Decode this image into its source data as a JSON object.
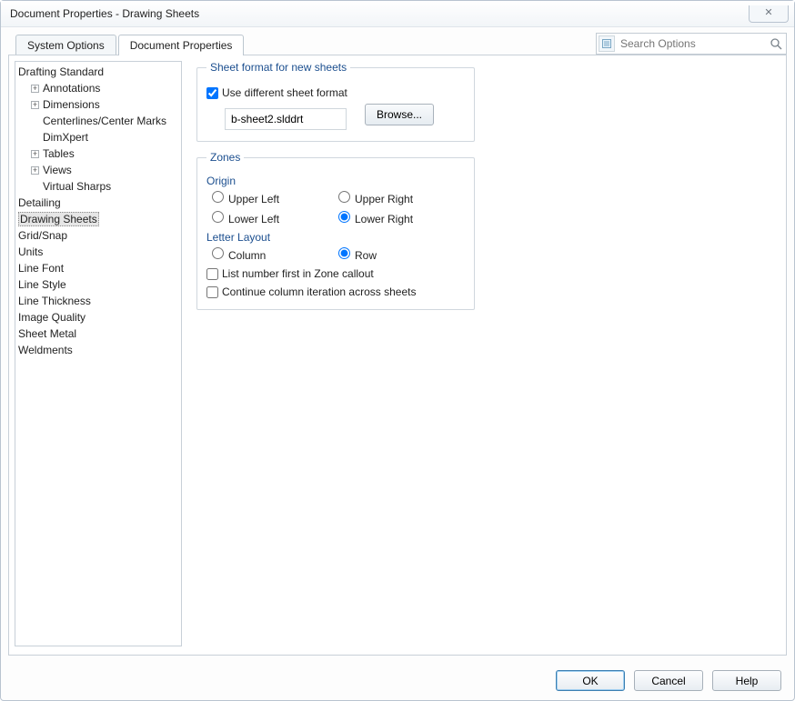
{
  "title": "Document Properties - Drawing Sheets",
  "tabs": {
    "system": "System Options",
    "doc": "Document Properties"
  },
  "search_placeholder": "Search Options",
  "tree": {
    "root": "Drafting Standard",
    "annotations": "Annotations",
    "dimensions": "Dimensions",
    "centerlines": "Centerlines/Center Marks",
    "dimxpert": "DimXpert",
    "tables": "Tables",
    "views": "Views",
    "virtual_sharps": "Virtual Sharps",
    "detailing": "Detailing",
    "drawing_sheets": "Drawing Sheets",
    "grid_snap": "Grid/Snap",
    "units": "Units",
    "line_font": "Line Font",
    "line_style": "Line Style",
    "line_thickness": "Line Thickness",
    "image_quality": "Image Quality",
    "sheet_metal": "Sheet Metal",
    "weldments": "Weldments"
  },
  "groups": {
    "sheet_format": "Sheet format for new sheets",
    "zones": "Zones",
    "origin": "Origin",
    "letter_layout": "Letter Layout"
  },
  "controls": {
    "use_diff_format": "Use different sheet format",
    "format_value": "b-sheet2.slddrt",
    "browse": "Browse...",
    "upper_left": "Upper Left",
    "upper_right": "Upper Right",
    "lower_left": "Lower Left",
    "lower_right": "Lower Right",
    "column": "Column",
    "row": "Row",
    "list_first": "List number first in Zone callout",
    "continue_iter": "Continue column iteration across sheets"
  },
  "buttons": {
    "ok": "OK",
    "cancel": "Cancel",
    "help": "Help"
  }
}
